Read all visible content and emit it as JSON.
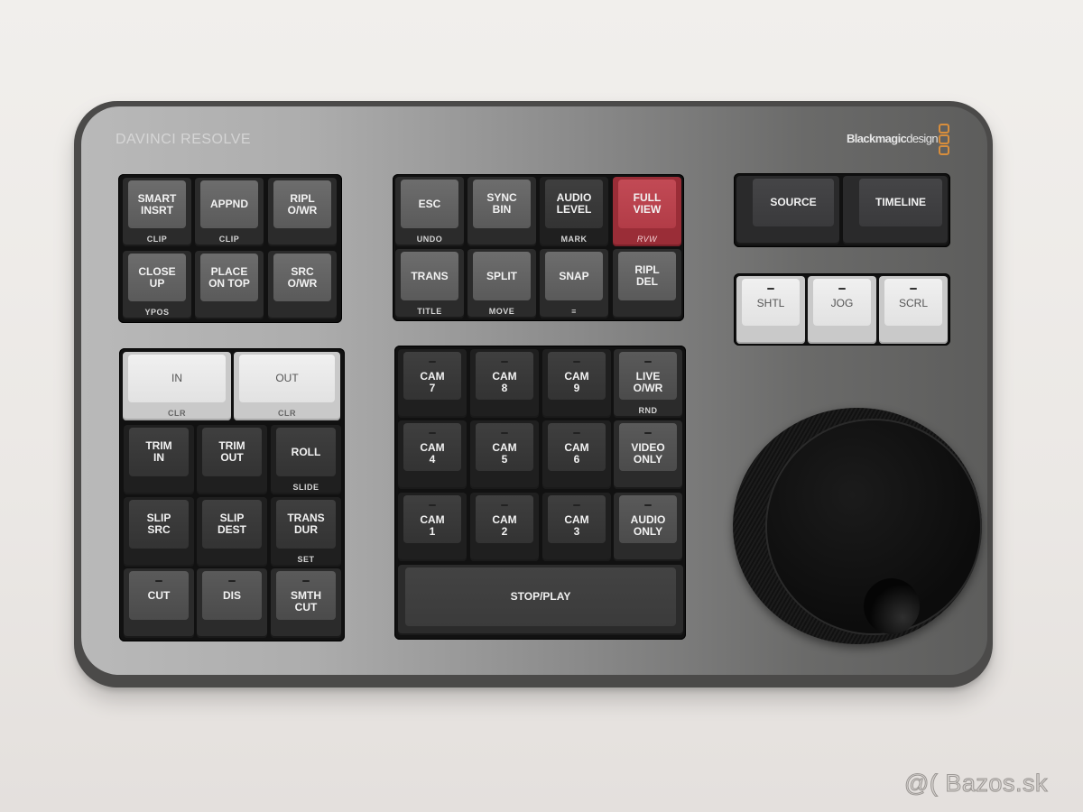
{
  "device": {
    "product_label": "DAVINCI RESOLVE",
    "brand_name_bold": "Blackmagic",
    "brand_name_light": "design",
    "colors": {
      "metal_light": "#b9b9b9",
      "metal_dark": "#5d5d5c",
      "key_grey": "#5a5a5a",
      "key_red": "#b23c47",
      "key_white": "#e8e8e8",
      "logo_orange": "#d88e3c"
    }
  },
  "edit_keys": [
    {
      "label": "SMART\nINSRT",
      "sub": "CLIP"
    },
    {
      "label": "APPND",
      "sub": "CLIP"
    },
    {
      "label": "RIPL\nO/WR",
      "sub": ""
    },
    {
      "label": "CLOSE\nUP",
      "sub": "YPOS"
    },
    {
      "label": "PLACE\nON TOP",
      "sub": ""
    },
    {
      "label": "SRC\nO/WR",
      "sub": ""
    }
  ],
  "function_keys": [
    {
      "label": "ESC",
      "sub": "UNDO"
    },
    {
      "label": "SYNC\nBIN",
      "sub": ""
    },
    {
      "label": "AUDIO\nLEVEL",
      "sub": "MARK"
    },
    {
      "label": "FULL\nVIEW",
      "sub": "RVW"
    },
    {
      "label": "TRANS",
      "sub": "TITLE"
    },
    {
      "label": "SPLIT",
      "sub": "MOVE"
    },
    {
      "label": "SNAP",
      "sub": "≡"
    },
    {
      "label": "RIPL\nDEL",
      "sub": ""
    }
  ],
  "view_keys": [
    {
      "label": "SOURCE"
    },
    {
      "label": "TIMELINE"
    }
  ],
  "mode_keys": [
    {
      "label": "SHTL"
    },
    {
      "label": "JOG"
    },
    {
      "label": "SCRL"
    }
  ],
  "in_out_keys": [
    {
      "label": "IN",
      "sub": "CLR"
    },
    {
      "label": "OUT",
      "sub": "CLR"
    }
  ],
  "trim_keys": [
    {
      "label": "TRIM\nIN",
      "sub": ""
    },
    {
      "label": "TRIM\nOUT",
      "sub": ""
    },
    {
      "label": "ROLL",
      "sub": "SLIDE"
    },
    {
      "label": "SLIP\nSRC",
      "sub": ""
    },
    {
      "label": "SLIP\nDEST",
      "sub": ""
    },
    {
      "label": "TRANS\nDUR",
      "sub": "SET"
    },
    {
      "label": "CUT",
      "sub": ""
    },
    {
      "label": "DIS",
      "sub": ""
    },
    {
      "label": "SMTH\nCUT",
      "sub": ""
    }
  ],
  "camera_keys": [
    {
      "label": "CAM\n7",
      "sub": ""
    },
    {
      "label": "CAM\n8",
      "sub": ""
    },
    {
      "label": "CAM\n9",
      "sub": ""
    },
    {
      "label": "LIVE\nO/WR",
      "sub": "RND"
    },
    {
      "label": "CAM\n4",
      "sub": ""
    },
    {
      "label": "CAM\n5",
      "sub": ""
    },
    {
      "label": "CAM\n6",
      "sub": ""
    },
    {
      "label": "VIDEO\nONLY",
      "sub": ""
    },
    {
      "label": "CAM\n1",
      "sub": ""
    },
    {
      "label": "CAM\n2",
      "sub": ""
    },
    {
      "label": "CAM\n3",
      "sub": ""
    },
    {
      "label": "AUDIO\nONLY",
      "sub": ""
    }
  ],
  "transport": {
    "stop_play": "STOP/PLAY"
  },
  "jog_wheel": {
    "name": "search dial"
  },
  "watermark": "@( Bazos.sk"
}
